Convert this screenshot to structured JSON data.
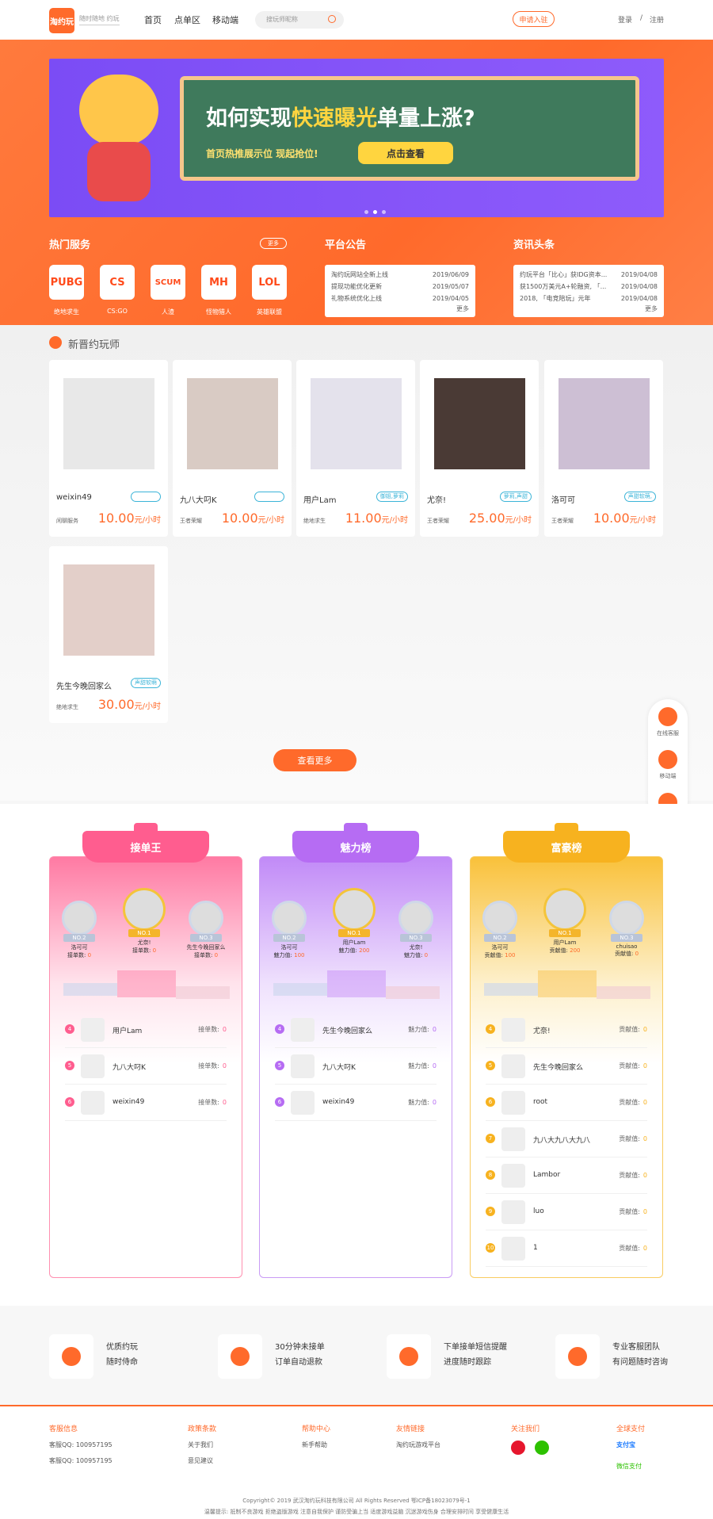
{
  "header": {
    "logo": "淘约玩",
    "logo_sub": "随时随地 约玩",
    "nav": [
      "首页",
      "点单区",
      "移动端"
    ],
    "search_placeholder": "搜玩师昵称",
    "apply": "申请入驻",
    "login": "登录",
    "sep": "/",
    "register": "注册"
  },
  "banner": {
    "title_a": "如何实现",
    "title_b": "快速曝光",
    "title_c": "单量上涨?",
    "sub": "首页热推展示位 现起抢位!",
    "button": "点击查看"
  },
  "hot": {
    "title": "热门服务",
    "more": "更多",
    "items": [
      {
        "icon": "PUBG",
        "label": "绝地求生"
      },
      {
        "icon": "CS",
        "label": "CS:GO"
      },
      {
        "icon": "SCUM",
        "label": "人渣"
      },
      {
        "icon": "MH",
        "label": "怪物猎人"
      },
      {
        "icon": "LOL",
        "label": "英雄联盟"
      }
    ]
  },
  "notice": {
    "title": "平台公告",
    "rows": [
      {
        "t": "淘约玩网站全新上线",
        "d": "2019/06/09"
      },
      {
        "t": "提现功能优化更新",
        "d": "2019/05/07"
      },
      {
        "t": "礼物系统优化上线",
        "d": "2019/04/05"
      }
    ],
    "more": "更多"
  },
  "news": {
    "title": "资讯头条",
    "rows": [
      {
        "t": "约玩平台「比心」获IDG资本...",
        "d": "2019/04/08"
      },
      {
        "t": "获1500万美元A+轮融资, 「...",
        "d": "2019/04/08"
      },
      {
        "t": "2018, 「电竞陪玩」元年",
        "d": "2019/04/08"
      }
    ],
    "more": "更多"
  },
  "players": {
    "title": "新晋约玩师",
    "cards": [
      {
        "name": "weixin49",
        "tag": "",
        "game": "闲聊服务",
        "price": "10.00",
        "unit": "元/小时"
      },
      {
        "name": "九八大叼K",
        "tag": "",
        "game": "王者荣耀",
        "price": "10.00",
        "unit": "元/小时"
      },
      {
        "name": "用户Lam",
        "tag": "御姐,萝莉",
        "game": "绝地求生",
        "price": "11.00",
        "unit": "元/小时"
      },
      {
        "name": "尤奈!",
        "tag": "萝莉,声甜",
        "game": "王者荣耀",
        "price": "25.00",
        "unit": "元/小时"
      },
      {
        "name": "洛可可",
        "tag": "声甜软萌,",
        "game": "王者荣耀",
        "price": "10.00",
        "unit": "元/小时"
      },
      {
        "name": "先生今晚回家么",
        "tag": "声甜软萌",
        "game": "绝地求生",
        "price": "30.00",
        "unit": "元/小时"
      }
    ],
    "see_more": "查看更多"
  },
  "float": {
    "service": "在线客服",
    "mobile": "移动端"
  },
  "ranks": [
    {
      "title": "接单王",
      "color": "#ff5d8f",
      "podium": [
        {
          "badge": "NO.2",
          "name": "洛可可",
          "label": "接单数:",
          "val": "0"
        },
        {
          "badge": "NO.1",
          "name": "尤奈!",
          "label": "接单数:",
          "val": "0"
        },
        {
          "badge": "NO.3",
          "name": "先生今晚回家么",
          "label": "接单数:",
          "val": "0"
        }
      ],
      "list": [
        {
          "n": "4",
          "name": "用户Lam",
          "label": "接单数:",
          "val": "0"
        },
        {
          "n": "5",
          "name": "九八大叼K",
          "label": "接单数:",
          "val": "0"
        },
        {
          "n": "6",
          "name": "weixin49",
          "label": "接单数:",
          "val": "0"
        }
      ]
    },
    {
      "title": "魅力榜",
      "color": "#b66cf3",
      "podium": [
        {
          "badge": "NO.2",
          "name": "洛可可",
          "label": "魅力值:",
          "val": "100"
        },
        {
          "badge": "NO.1",
          "name": "用户Lam",
          "label": "魅力值:",
          "val": "200"
        },
        {
          "badge": "NO.3",
          "name": "尤奈!",
          "label": "魅力值:",
          "val": "0"
        }
      ],
      "list": [
        {
          "n": "4",
          "name": "先生今晚回家么",
          "label": "魅力值:",
          "val": "0"
        },
        {
          "n": "5",
          "name": "九八大叼K",
          "label": "魅力值:",
          "val": "0"
        },
        {
          "n": "6",
          "name": "weixin49",
          "label": "魅力值:",
          "val": "0"
        }
      ]
    },
    {
      "title": "富豪榜",
      "color": "#f7b21f",
      "podium": [
        {
          "badge": "NO.2",
          "name": "洛可可",
          "label": "贡献值:",
          "val": "100"
        },
        {
          "badge": "NO.1",
          "name": "用户Lam",
          "label": "贡献值:",
          "val": "200"
        },
        {
          "badge": "NO.3",
          "name": "chuisao",
          "label": "贡献值:",
          "val": "0"
        }
      ],
      "list": [
        {
          "n": "4",
          "name": "尤奈!",
          "label": "贡献值:",
          "val": "0"
        },
        {
          "n": "5",
          "name": "先生今晚回家么",
          "label": "贡献值:",
          "val": "0"
        },
        {
          "n": "6",
          "name": "root",
          "label": "贡献值:",
          "val": "0"
        },
        {
          "n": "7",
          "name": "九八大九八大九八",
          "label": "贡献值:",
          "val": "0"
        },
        {
          "n": "8",
          "name": "Lambor",
          "label": "贡献值:",
          "val": "0"
        },
        {
          "n": "9",
          "name": "luo",
          "label": "贡献值:",
          "val": "0"
        },
        {
          "n": "10",
          "name": "1",
          "label": "贡献值:",
          "val": "0"
        }
      ]
    }
  ],
  "features": [
    {
      "l1": "优质约玩",
      "l2": "随时侍命"
    },
    {
      "l1": "30分钟未接单",
      "l2": "订单自动退款"
    },
    {
      "l1": "下单接单短信提醒",
      "l2": "进度随时跟踪"
    },
    {
      "l1": "专业客服团队",
      "l2": "有问题随时咨询"
    }
  ],
  "footer": {
    "cols": [
      {
        "h": "客服信息",
        "links": [
          "客服QQ: 100957195",
          "客服QQ: 100957195"
        ]
      },
      {
        "h": "政策条款",
        "links": [
          "关于我们",
          "意见建议"
        ]
      },
      {
        "h": "帮助中心",
        "links": [
          "新手帮助"
        ]
      },
      {
        "h": "友情链接",
        "links": [
          "淘约玩游戏平台"
        ]
      },
      {
        "h": "关注我们",
        "links": []
      },
      {
        "h": "全球支付",
        "links": [
          "支付宝",
          "微信支付"
        ]
      }
    ],
    "copyright": "Copyright© 2019 武汉淘约玩科技有限公司 All Rights Reserved 鄂ICP备18023079号-1",
    "tips": "温馨提示: 抵制不良游戏 拒绝盗版游戏 注意自我保护 谨防受骗上当 适度游戏益脑 沉迷游戏伤身 合理安排时间 享受健康生活"
  }
}
